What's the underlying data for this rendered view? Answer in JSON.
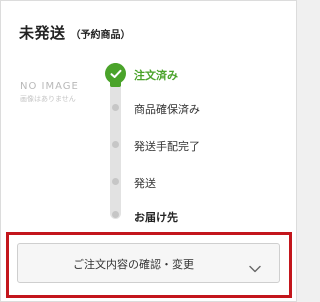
{
  "header": {
    "title": "未発送",
    "subtitle": "（予約商品）"
  },
  "product_image": {
    "placeholder_title": "NO IMAGE",
    "placeholder_sub": "画像はありません"
  },
  "progress": {
    "steps": [
      {
        "label": "注文済み",
        "state": "done"
      },
      {
        "label": "商品確保済み",
        "state": "pending"
      },
      {
        "label": "発送手配完了",
        "state": "pending"
      },
      {
        "label": "発送",
        "state": "pending"
      },
      {
        "label": "お届け先",
        "state": "pending"
      }
    ],
    "completed_fraction": 0.0,
    "accent_color": "#4aa32a"
  },
  "actions": {
    "confirm_label": "ご注文内容の確認・変更",
    "confirm_icon": "chevron-down-icon",
    "highlight_color": "#c3161c"
  }
}
